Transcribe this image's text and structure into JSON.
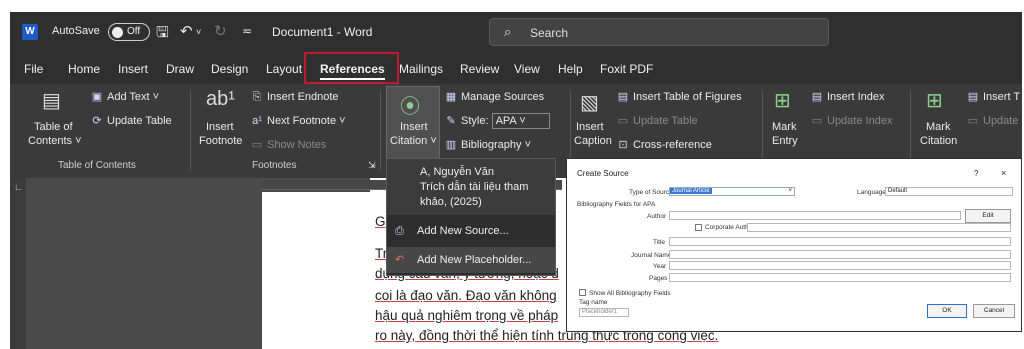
{
  "titlebar": {
    "app_logo": "W",
    "autosave_label": "AutoSave",
    "autosave_state": "Off",
    "document_title": "Document1  -  Word",
    "search_placeholder": "Search"
  },
  "tabs": [
    "File",
    "Home",
    "Insert",
    "Draw",
    "Design",
    "Layout",
    "References",
    "Mailings",
    "Review",
    "View",
    "Help",
    "Foxit PDF"
  ],
  "active_tab": "References",
  "ribbon": {
    "toc": {
      "table_of_contents": "Table of",
      "table_of_contents_2": "Contents ˅",
      "add_text": "Add Text ˅",
      "update_table": "Update Table",
      "group_label": "Table of Contents"
    },
    "footnotes": {
      "insert_footnote": "Insert",
      "insert_footnote_2": "Footnote",
      "insert_endnote": "Insert Endnote",
      "next_footnote": "Next Footnote",
      "show_notes": "Show Notes",
      "group_label": "Footnotes"
    },
    "citations": {
      "insert_citation": "Insert",
      "insert_citation_2": "Citation ˅",
      "manage_sources": "Manage Sources",
      "style_label": "Style:",
      "style_value": "APA",
      "bibliography": "Bibliography ˅"
    },
    "captions": {
      "insert_caption": "Insert",
      "insert_caption_2": "Caption",
      "insert_table_of_figures": "Insert Table of Figures",
      "update_table": "Update Table",
      "cross_reference": "Cross-reference"
    },
    "index": {
      "mark_entry": "Mark",
      "mark_entry_2": "Entry",
      "insert_index": "Insert Index",
      "update_index": "Update Index"
    },
    "toa": {
      "mark_citation": "Mark",
      "mark_citation_2": "Citation",
      "insert_toa": "Insert T",
      "update": "Update"
    }
  },
  "citation_dropdown": {
    "existing_citation": [
      "A, Nguyễn Văn",
      "Trích dẫn tài liệu tham",
      "khảo, (2025)"
    ],
    "add_new_source": "Add New Source...",
    "add_new_placeholder": "Add New Placeholder..."
  },
  "document": {
    "lines": [
      "G",
      "Tr",
      "dụng câu văn, ý tưởng, hoặc d",
      "coi là đạo văn. Đạo văn không",
      "hậu quả nghiêm trọng về pháp",
      "ro này, đồng thời thể hiện tính trung thực trong công việc."
    ]
  },
  "create_source_dialog": {
    "title": "Create Source",
    "help": "?",
    "close": "×",
    "type_of_source_label": "Type of Source",
    "type_of_source_value": "Journal Article",
    "language_label": "Language",
    "language_value": "Default",
    "bibliography_fields_label": "Bibliography Fields for APA",
    "author_label": "Author",
    "edit_button": "Edit",
    "corporate_author_label": "Corporate Author",
    "title_label": "Title",
    "journal_name_label": "Journal Name",
    "year_label": "Year",
    "pages_label": "Pages",
    "show_all_label": "Show All Bibliography Fields",
    "tag_name_label": "Tag name",
    "tag_name_value": "Placeholder1",
    "ok_button": "OK",
    "cancel_button": "Cancel"
  }
}
